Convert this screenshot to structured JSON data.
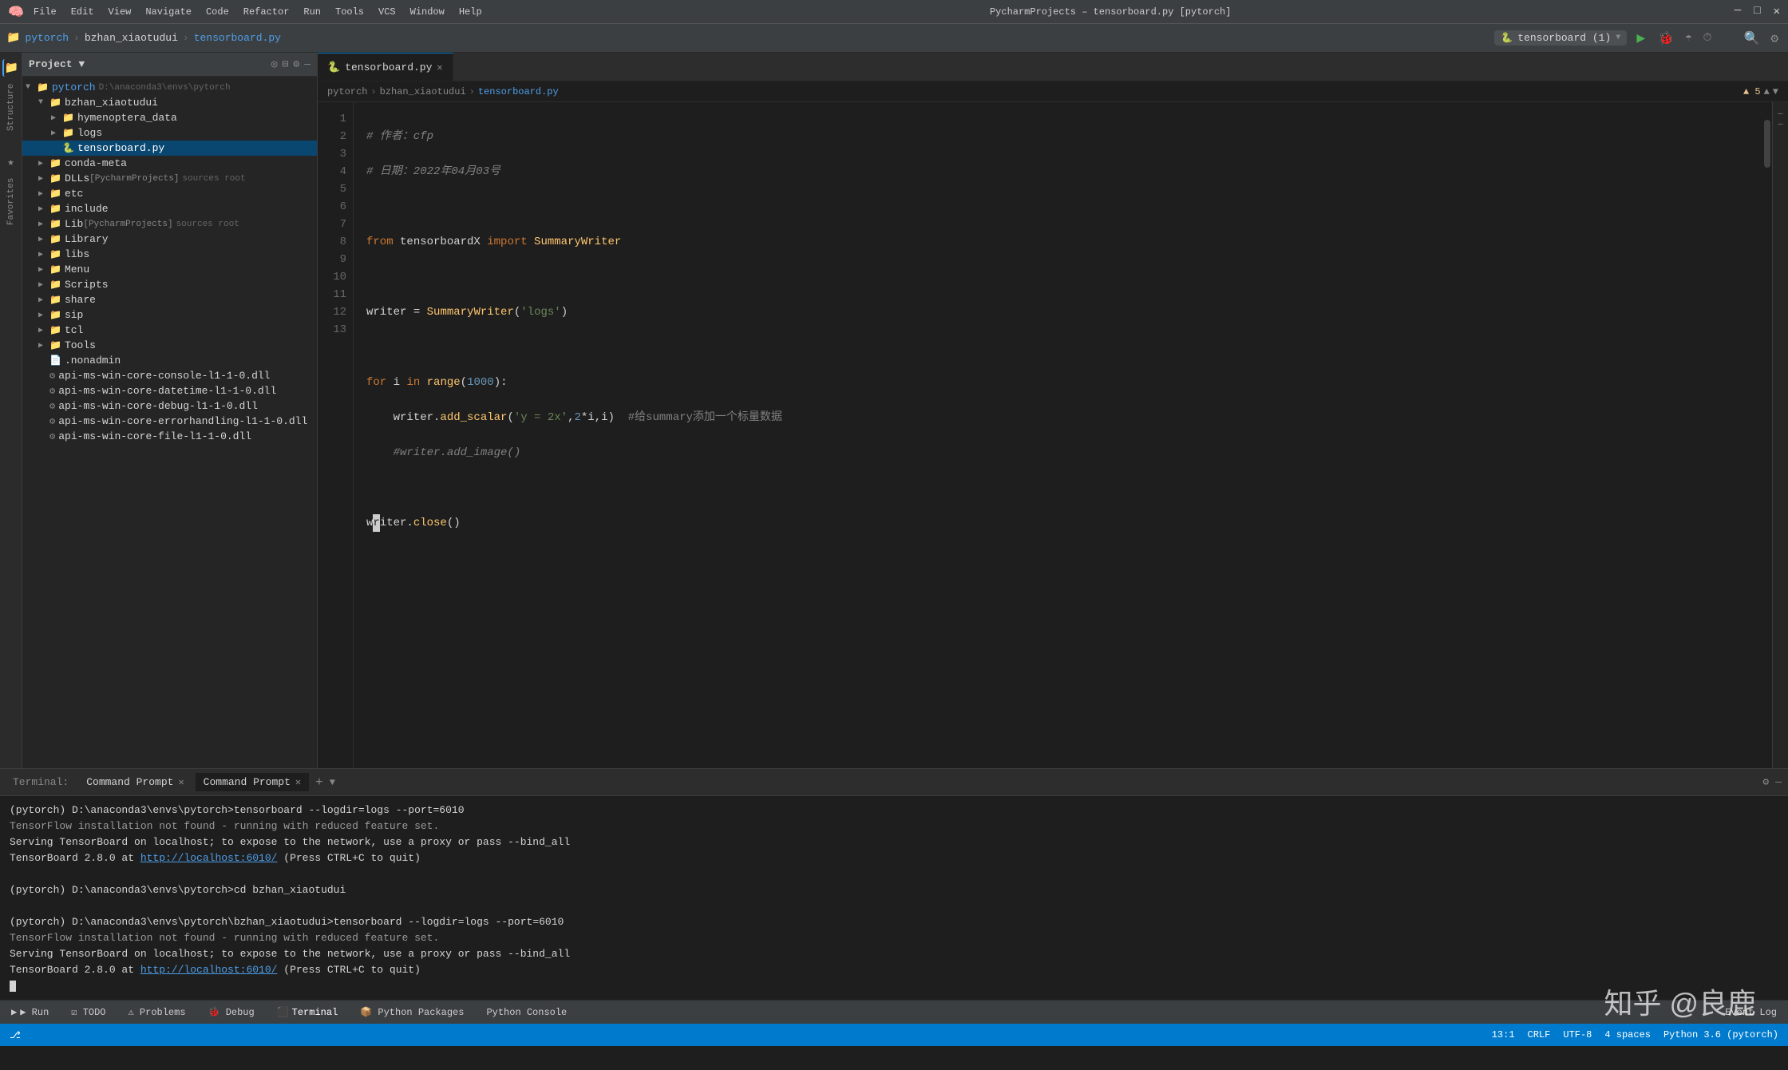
{
  "titlebar": {
    "project_path": "PycharmProjects – tensorboard.py [pytorch]",
    "btn_minimize": "─",
    "btn_maximize": "□",
    "btn_close": "✕"
  },
  "breadcrumb_nav": {
    "part1": "pytorch",
    "sep1": "›",
    "part2": "bzhan_xiaotudui",
    "sep2": "›",
    "part3": "tensorboard.py"
  },
  "menubar": {
    "items": [
      "File",
      "Edit",
      "View",
      "Navigate",
      "Code",
      "Refactor",
      "Run",
      "Tools",
      "VCS",
      "Window",
      "Help"
    ]
  },
  "toolbar": {
    "project_label": "pytorch",
    "run_config": "tensorboard (1)",
    "run_btn": "▶",
    "debug_btn": "🐞"
  },
  "project_panel": {
    "title": "Project",
    "root": "pytorch",
    "root_path": "D:\\anaconda3\\envs\\pytorch",
    "items": [
      {
        "id": "bzhan_xiaotudui",
        "label": "bzhan_xiaotudui",
        "type": "folder",
        "indent": 1,
        "expanded": true
      },
      {
        "id": "hymenoptera_data",
        "label": "hymenoptera_data",
        "type": "folder",
        "indent": 2,
        "expanded": false
      },
      {
        "id": "logs",
        "label": "logs",
        "type": "folder",
        "indent": 2,
        "expanded": false
      },
      {
        "id": "tensorboard.py",
        "label": "tensorboard.py",
        "type": "file-py",
        "indent": 2,
        "expanded": false
      },
      {
        "id": "conda-meta",
        "label": "conda-meta",
        "type": "folder",
        "indent": 1,
        "expanded": false
      },
      {
        "id": "DLLs",
        "label": "DLLs [PycharmProjects]",
        "type": "folder-src",
        "indent": 1,
        "expanded": false
      },
      {
        "id": "etc",
        "label": "etc",
        "type": "folder",
        "indent": 1,
        "expanded": false
      },
      {
        "id": "include",
        "label": "include",
        "type": "folder",
        "indent": 1,
        "expanded": false
      },
      {
        "id": "Lib",
        "label": "Lib [PycharmProjects]",
        "type": "folder-src",
        "indent": 1,
        "expanded": false
      },
      {
        "id": "Library",
        "label": "Library",
        "type": "folder",
        "indent": 1,
        "expanded": false
      },
      {
        "id": "libs",
        "label": "libs",
        "type": "folder",
        "indent": 1,
        "expanded": false
      },
      {
        "id": "Menu",
        "label": "Menu",
        "type": "folder",
        "indent": 1,
        "expanded": false
      },
      {
        "id": "Scripts",
        "label": "Scripts",
        "type": "folder",
        "indent": 1,
        "expanded": false
      },
      {
        "id": "share",
        "label": "share",
        "type": "folder",
        "indent": 1,
        "expanded": false
      },
      {
        "id": "sip",
        "label": "sip",
        "type": "folder",
        "indent": 1,
        "expanded": false
      },
      {
        "id": "tcl",
        "label": "tcl",
        "type": "folder",
        "indent": 1,
        "expanded": false
      },
      {
        "id": "Tools",
        "label": "Tools",
        "type": "folder",
        "indent": 1,
        "expanded": false
      },
      {
        "id": ".nonadmin",
        "label": ".nonadmin",
        "type": "file",
        "indent": 1,
        "expanded": false
      },
      {
        "id": "api-ms1",
        "label": "api-ms-win-core-console-l1-1-0.dll",
        "type": "file-dll",
        "indent": 1
      },
      {
        "id": "api-ms2",
        "label": "api-ms-win-core-datetime-l1-1-0.dll",
        "type": "file-dll",
        "indent": 1
      },
      {
        "id": "api-ms3",
        "label": "api-ms-win-core-debug-l1-1-0.dll",
        "type": "file-dll",
        "indent": 1
      },
      {
        "id": "api-ms4",
        "label": "api-ms-win-core-errorhandling-l1-1-0.dll",
        "type": "file-dll",
        "indent": 1
      },
      {
        "id": "api-ms5",
        "label": "api-ms-win-core-file-l1-1-0.dll",
        "type": "file-dll",
        "indent": 1
      }
    ]
  },
  "editor": {
    "tab_label": "tensorboard.py",
    "tab_close": "✕",
    "lines": [
      {
        "num": 1,
        "code": "comment_author"
      },
      {
        "num": 2,
        "code": "comment_date"
      },
      {
        "num": 3,
        "code": ""
      },
      {
        "num": 4,
        "code": "from tensorboardX import SummaryWriter"
      },
      {
        "num": 5,
        "code": ""
      },
      {
        "num": 6,
        "code": "writer = SummaryWriter('logs')"
      },
      {
        "num": 7,
        "code": ""
      },
      {
        "num": 8,
        "code": "for i in range(1000):"
      },
      {
        "num": 9,
        "code": "    writer.add_scalar('y = 2x', 2*i, i)  #给summary添加一个标量数据"
      },
      {
        "num": 10,
        "code": "    #writer.add_image()"
      },
      {
        "num": 11,
        "code": ""
      },
      {
        "num": 12,
        "code": "writer.close()"
      },
      {
        "num": 13,
        "code": ""
      }
    ],
    "comment_author": "## 作者：cfp",
    "comment_date": "## 日期：2022年04月03号"
  },
  "terminal": {
    "label": "Terminal:",
    "tabs": [
      {
        "label": "Command Prompt",
        "active": false
      },
      {
        "label": "Command Prompt",
        "active": true
      }
    ],
    "add_btn": "+",
    "lines": [
      "(pytorch) D:\\anaconda3\\envs\\pytorch>tensorboard --logdir=logs --port=6010",
      "TensorFlow installation not found - running with reduced feature set.",
      "Serving TensorBoard on localhost; to expose to the network, use a proxy or pass --bind_all",
      "TensorBoard 2.8.0 at http://localhost:6010/ (Press CTRL+C to quit)",
      "",
      "(pytorch) D:\\anaconda3\\envs\\pytorch>cd bzhan_xiaotudui",
      "",
      "(pytorch) D:\\anaconda3\\envs\\pytorch\\bzhan_xiaotudui>tensorboard --logdir=logs --port=6010",
      "TensorFlow installation not found - running with reduced feature set.",
      "Serving TensorBoard on localhost; to expose to the network, use a proxy or pass --bind_all",
      "TensorBoard 2.8.0 at http://localhost:6010/ (Press CTRL+C to quit)"
    ],
    "link_text": "http://localhost:6010/",
    "cursor": true
  },
  "bottom_bar": {
    "run_label": "▶ Run",
    "todo_label": "☑ TODO",
    "problems_label": "⚠ Problems",
    "debug_label": "🐞 Debug",
    "terminal_label": "Terminal",
    "python_packages_label": "📦 Python Packages",
    "python_console_label": "Python Console",
    "event_log_label": "Event Log"
  },
  "status_bar": {
    "left": "13:1  CRLF  UTF-8  4 spaces  Python 3.6 (pytorch)",
    "error_count": "▲ 5",
    "encoding": "UTF-8",
    "line_sep": "CRLF",
    "spaces": "4 spaces",
    "python_version": "Python 3.6 (pytorch)",
    "line_col": "13:1"
  },
  "watermark": "知乎 @良鹿"
}
